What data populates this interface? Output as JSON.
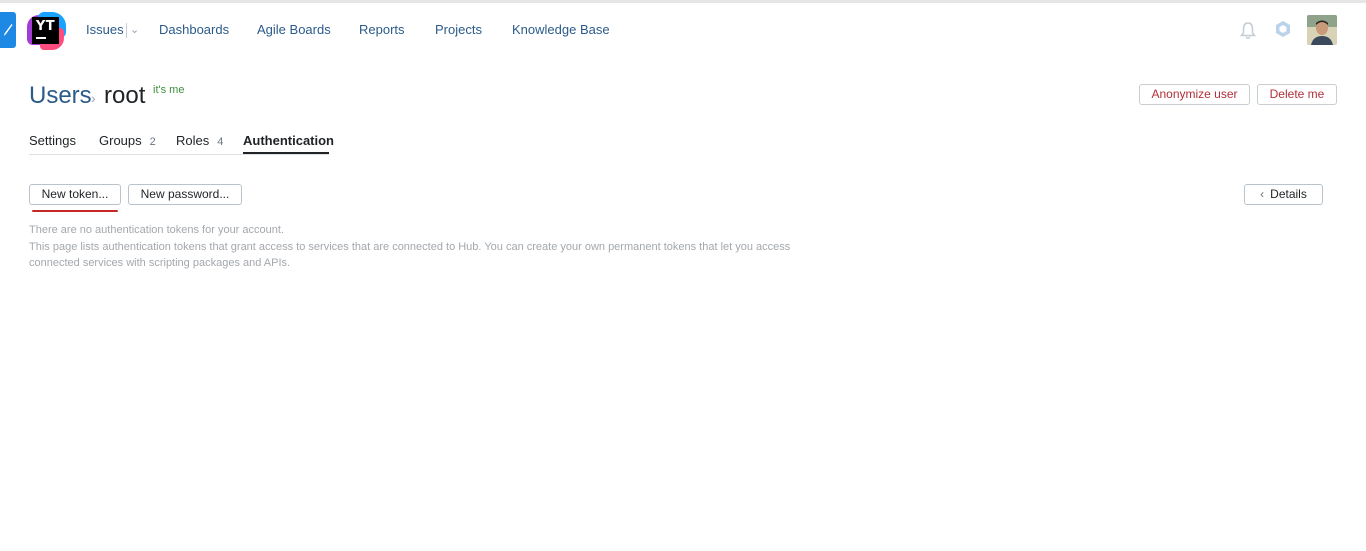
{
  "nav": {
    "items": [
      "Issues",
      "Dashboards",
      "Agile Boards",
      "Reports",
      "Projects",
      "Knowledge Base"
    ]
  },
  "logo": {
    "text": "YT"
  },
  "header_icons": [
    "notification-bell-icon",
    "hub-hexagon-icon",
    "user-avatar"
  ],
  "breadcrumb": {
    "parent": "Users",
    "current": "root",
    "badge": "it's me"
  },
  "actions": {
    "anonymize": "Anonymize user",
    "delete": "Delete me"
  },
  "tabs": [
    {
      "label": "Settings",
      "count": ""
    },
    {
      "label": "Groups",
      "count": "2"
    },
    {
      "label": "Roles",
      "count": "4"
    },
    {
      "label": "Authentication",
      "count": ""
    }
  ],
  "toolbar": {
    "new_token": "New token...",
    "new_password": "New password...",
    "details": "Details"
  },
  "info": {
    "empty": "There are no authentication tokens for your account.",
    "line2": "This page lists authentication tokens that grant access to services that are connected to Hub. You can create your own permanent tokens that let you access",
    "line3": "connected services with scripting packages and APIs."
  },
  "colors": {
    "link": "#2b5b8a",
    "accent": "#1e88e5",
    "danger": "#b0303b",
    "badge": "#3f8f3f"
  }
}
